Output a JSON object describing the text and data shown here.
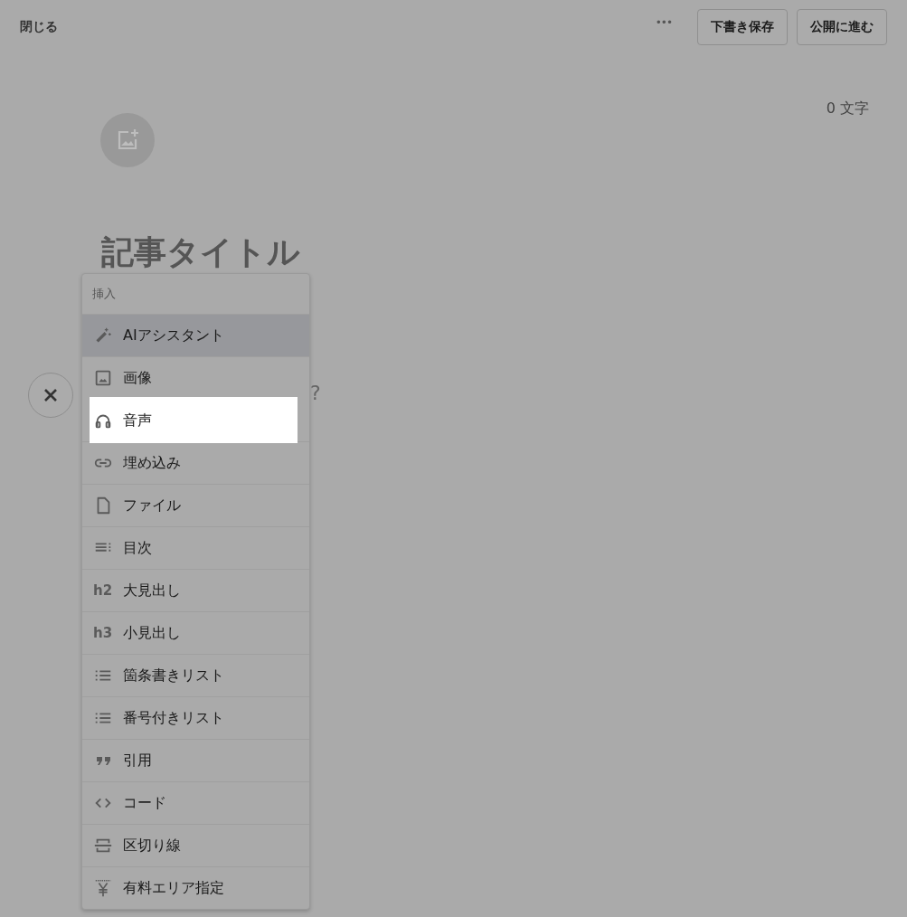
{
  "topbar": {
    "close_label": "閉じる",
    "more_label": "•••",
    "buttons": [
      "下書き保存",
      "公開に進む"
    ]
  },
  "editor": {
    "char_count": "0 文字",
    "title_placeholder": "記事タイトル",
    "body_hint": "?"
  },
  "insert_menu": {
    "header": "挿入",
    "items": [
      {
        "label": "AIアシスタント",
        "hovered": true,
        "spotlight": false
      },
      {
        "label": "画像",
        "hovered": false,
        "spotlight": false
      },
      {
        "label": "音声",
        "hovered": false,
        "spotlight": true
      },
      {
        "label": "埋め込み",
        "hovered": false,
        "spotlight": false
      },
      {
        "label": "ファイル",
        "hovered": false,
        "spotlight": false
      },
      {
        "label": "目次",
        "hovered": false,
        "spotlight": false
      },
      {
        "label": "大見出し",
        "icon_text": "h2",
        "hovered": false,
        "spotlight": false
      },
      {
        "label": "小見出し",
        "icon_text": "h3",
        "hovered": false,
        "spotlight": false
      },
      {
        "label": "箇条書きリスト",
        "hovered": false,
        "spotlight": false
      },
      {
        "label": "番号付きリスト",
        "hovered": false,
        "spotlight": false
      },
      {
        "label": "引用",
        "hovered": false,
        "spotlight": false
      },
      {
        "label": "コード",
        "hovered": false,
        "spotlight": false
      },
      {
        "label": "区切り線",
        "hovered": false,
        "spotlight": false
      },
      {
        "label": "有料エリア指定",
        "hovered": false,
        "spotlight": false
      }
    ]
  }
}
